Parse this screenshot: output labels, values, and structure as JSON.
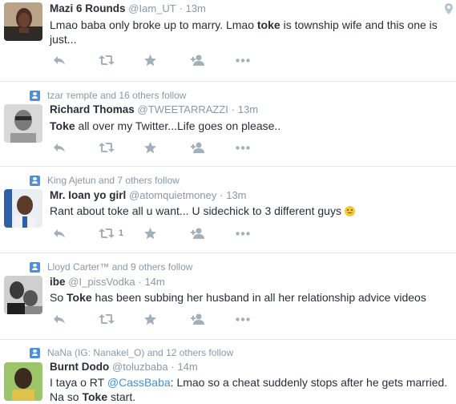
{
  "colors": {
    "accent": "#3b94d9",
    "muted": "#8899a6",
    "text": "#292f33",
    "divider": "#e1e8ed"
  },
  "tweets": [
    {
      "context": "",
      "name": "Mazi 6 Rounds",
      "handle": "@Iam_UT",
      "dot": "·",
      "time": "13m",
      "text_a": "Lmao baba only broke up to marry. Lmao ",
      "keyword": "toke",
      "text_b": " is township wife and this one is just...",
      "retweets": "",
      "has_geo": true
    },
    {
      "context": "tzar тempℓe and 16 others follow",
      "name": "Richard Thomas",
      "handle": "@TWEETARRAZZI",
      "dot": "·",
      "time": "13m",
      "keyword": "Toke",
      "text_b": " all over my Twitter...Life goes on please..",
      "retweets": ""
    },
    {
      "context": "King Ajetun and 7 others follow",
      "name": "Mr. Ioan yo girl",
      "handle": "@atomquietmoney",
      "dot": "·",
      "time": "13m",
      "text": "Rant about toke all u want...  U sidechick to 3 different guys ",
      "emoji": "smiling-face-emoji",
      "retweets": "1"
    },
    {
      "context": "Lloyd Carter™ and 9 others follow",
      "name": "ibe",
      "handle": "@I_pissVodka",
      "dot": "·",
      "time": "14m",
      "text_a": "So ",
      "keyword": "Toke",
      "text_b": " has been subbing her husband in all her relationship advice videos",
      "retweets": ""
    },
    {
      "context": "NaNa (IG: Nanakel_O) and 12 others follow",
      "name": "Burnt Dodo",
      "handle": "@toluzbaba",
      "dot": "·",
      "time": "14m",
      "text_a": "I taya o RT ",
      "mention": "@CassBaba",
      "text_b": ": Lmao so a cheat suddenly stops after he gets married. Na so ",
      "keyword": "Toke",
      "text_c": " start.",
      "retweets": ""
    }
  ]
}
